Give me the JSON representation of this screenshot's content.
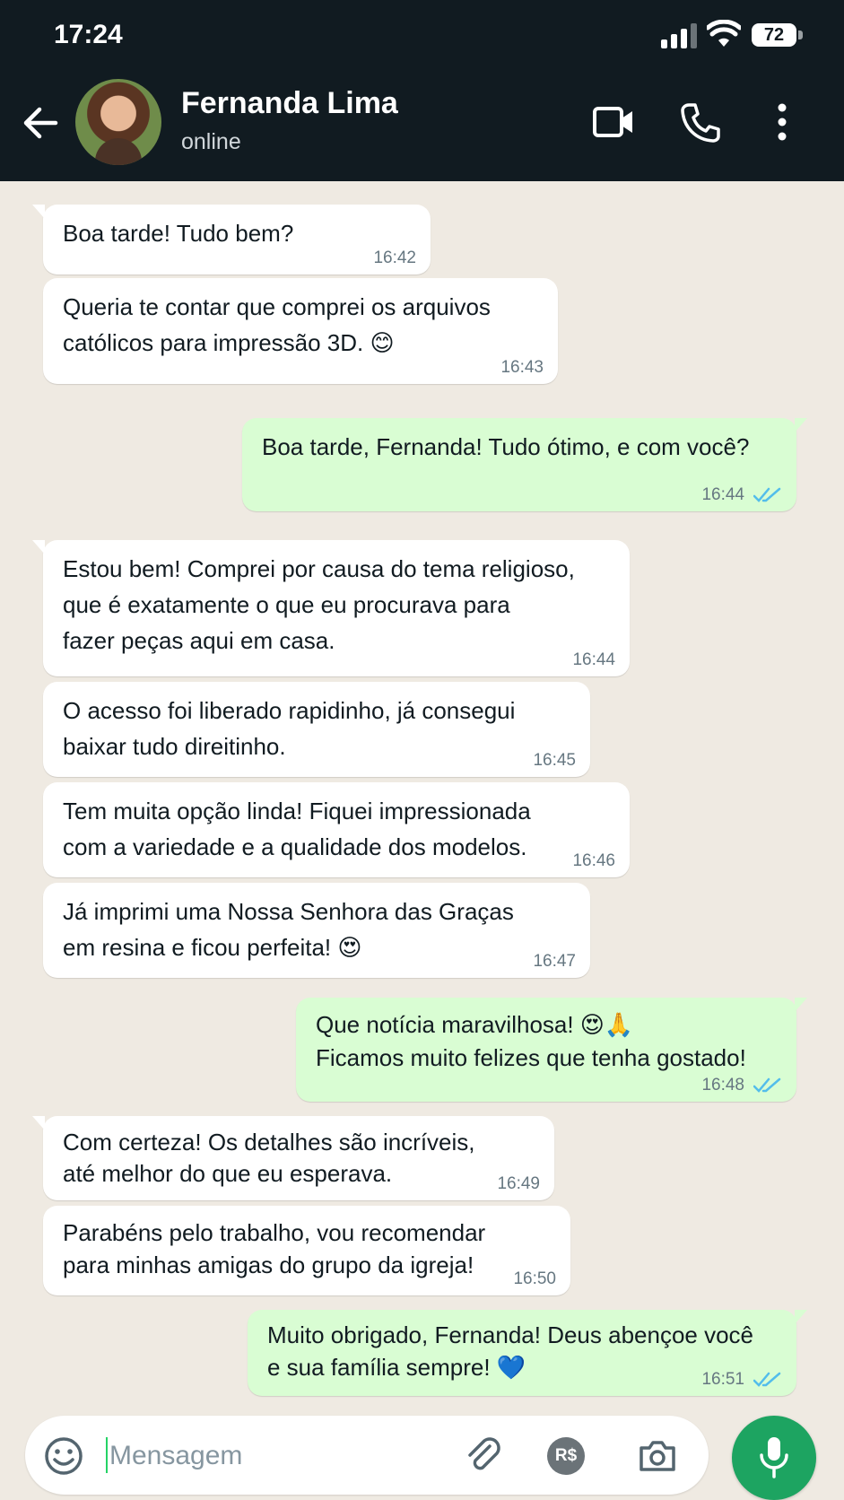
{
  "status_bar": {
    "time": "17:24",
    "battery": "72"
  },
  "header": {
    "contact_name": "Fernanda Lima",
    "contact_status": "online"
  },
  "messages": [
    {
      "dir": "in",
      "text": "Boa tarde! Tudo bem?",
      "time": "16:42"
    },
    {
      "dir": "in",
      "text": "Queria te contar que comprei os arquivos\ncatólicos para impressão 3D. 😊",
      "time": "16:43"
    },
    {
      "dir": "out",
      "text": "Boa tarde, Fernanda! Tudo ótimo, e com você?",
      "time": "16:44",
      "read": true
    },
    {
      "dir": "in",
      "text": "Estou bem! Comprei por causa do tema religioso,\nque é exatamente o que eu procurava para\nfazer peças aqui em casa.",
      "time": "16:44"
    },
    {
      "dir": "in",
      "text": "O acesso foi liberado rapidinho, já consegui\nbaixar tudo direitinho.",
      "time": "16:45"
    },
    {
      "dir": "in",
      "text": "Tem muita opção linda! Fiquei impressionada\ncom a variedade e a qualidade dos modelos.",
      "time": "16:46"
    },
    {
      "dir": "in",
      "text": "Já imprimi uma Nossa Senhora das Graças\nem resina e ficou perfeita! 😍",
      "time": "16:47"
    },
    {
      "dir": "out",
      "text": "Que notícia maravilhosa! 😍🙏\nFicamos muito felizes que tenha gostado!",
      "time": "16:48",
      "read": true
    },
    {
      "dir": "in",
      "text": "Com certeza! Os detalhes são incríveis,\naté melhor do que eu esperava.",
      "time": "16:49"
    },
    {
      "dir": "in",
      "text": "Parabéns pelo trabalho, vou recomendar\npara minhas amigas do grupo da igreja!",
      "time": "16:50"
    },
    {
      "dir": "out",
      "text": "Muito obrigado, Fernanda! Deus abençoe você\ne sua família sempre! 💙",
      "time": "16:51",
      "read": true
    }
  ],
  "composer": {
    "placeholder": "Mensagem",
    "payment_label": "R$"
  },
  "icons": {
    "back": "arrow-left-icon",
    "video": "video-camera-icon",
    "call": "phone-icon",
    "more": "more-vertical-icon",
    "emoji": "emoji-icon",
    "attach": "paperclip-icon",
    "camera": "camera-icon",
    "mic": "microphone-icon",
    "read_receipt": "double-check-icon"
  },
  "colors": {
    "header_bg": "#111b21",
    "chat_bg": "#efeae2",
    "incoming_bubble": "#ffffff",
    "outgoing_bubble": "#d9fdd3",
    "read_tick": "#53bdeb",
    "mic_button": "#1da461"
  }
}
